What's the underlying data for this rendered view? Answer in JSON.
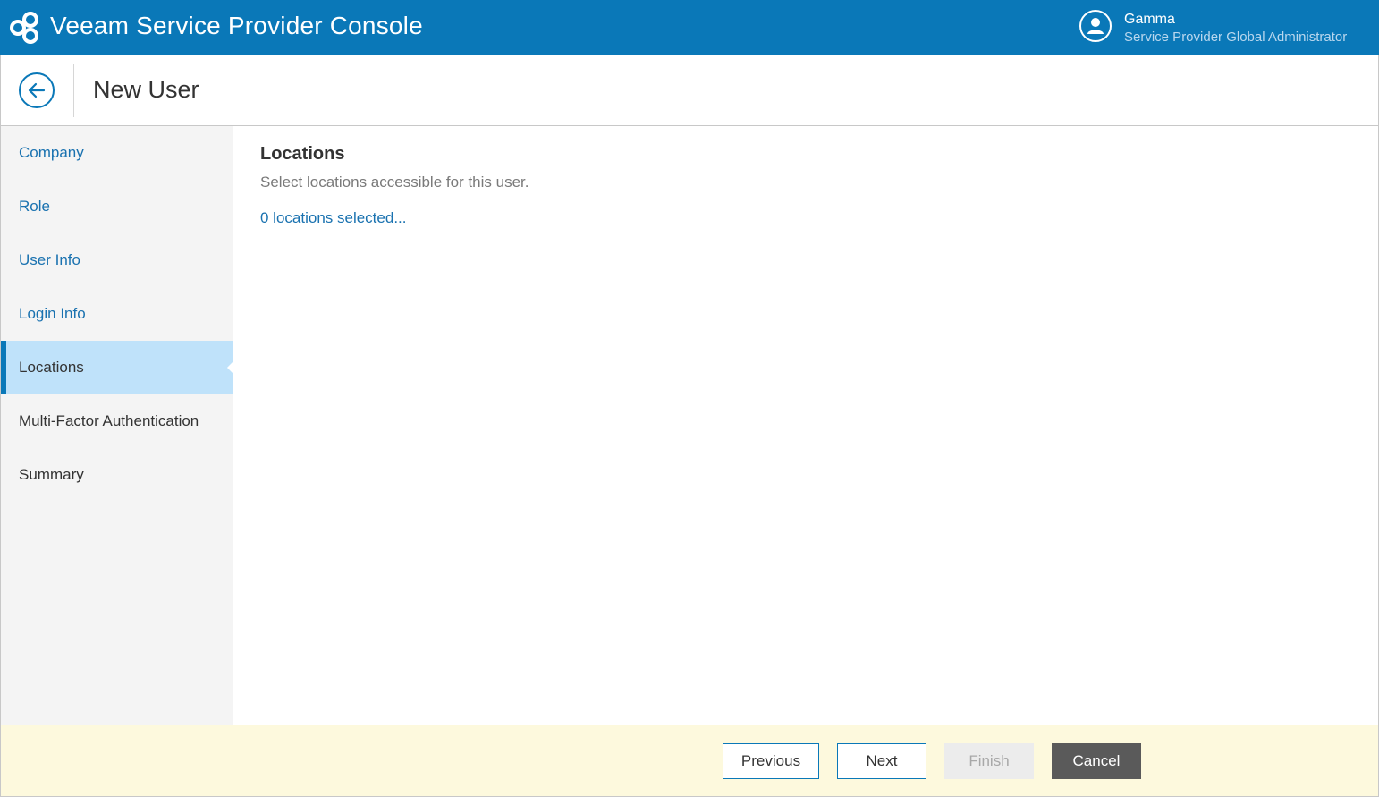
{
  "app": {
    "title": "Veeam Service Provider Console",
    "brand_color": "#0a78b8"
  },
  "user": {
    "name": "Gamma",
    "role": "Service Provider Global Administrator",
    "icon": "user-avatar-icon"
  },
  "header": {
    "back_icon": "back-arrow-icon",
    "title": "New User"
  },
  "sidebar": {
    "items": [
      {
        "label": "Company",
        "state": "link"
      },
      {
        "label": "Role",
        "state": "link"
      },
      {
        "label": "User Info",
        "state": "link"
      },
      {
        "label": "Login Info",
        "state": "link"
      },
      {
        "label": "Locations",
        "state": "active"
      },
      {
        "label": "Multi-Factor Authentication",
        "state": "plain"
      },
      {
        "label": "Summary",
        "state": "plain"
      }
    ]
  },
  "main": {
    "section_title": "Locations",
    "description": "Select locations accessible for this user.",
    "locations_link": "0 locations selected..."
  },
  "footer": {
    "previous_label": "Previous",
    "next_label": "Next",
    "finish_label": "Finish",
    "cancel_label": "Cancel"
  }
}
